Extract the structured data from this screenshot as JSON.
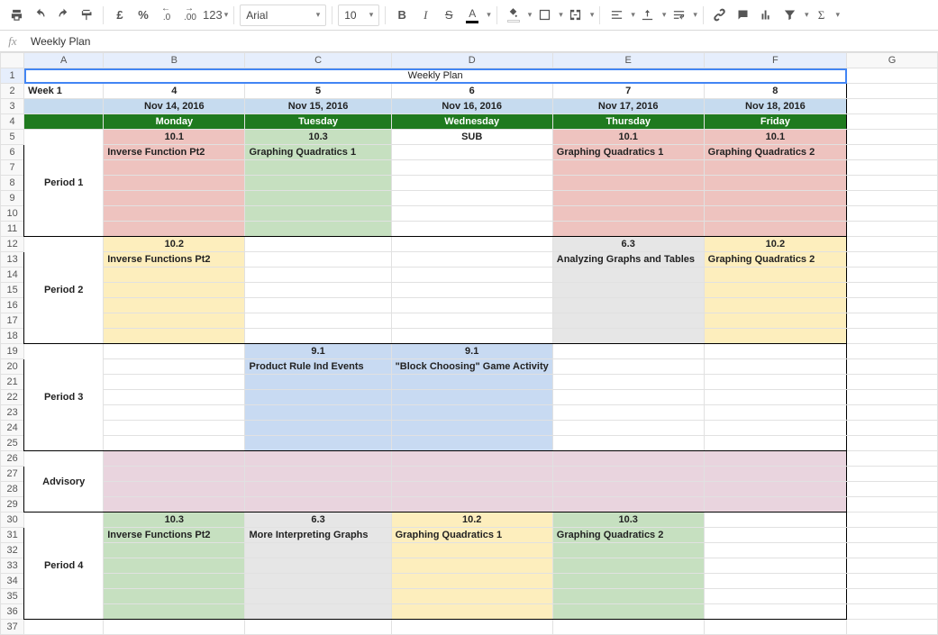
{
  "toolbar": {
    "font": "Arial",
    "size": "10",
    "currency_sym": "£",
    "percent": "%",
    "decimal_dec": ".0",
    "decimal_inc": ".00",
    "more_formats": "123",
    "bold": "B",
    "italic": "I",
    "strike": "S",
    "text_color": "A",
    "sigma": "Σ"
  },
  "formula_bar": {
    "fx": "fx",
    "value": "Weekly Plan"
  },
  "columns": [
    "A",
    "B",
    "C",
    "D",
    "E",
    "F",
    "G"
  ],
  "rows_count": 37,
  "colors": {
    "blue_header": "#c6dbef",
    "green_header": "#1f7a1f",
    "red_block": "#eec3bf",
    "green_block": "#c6e0c0",
    "yellow_block": "#fdeebd",
    "grey_block": "#e6e6e6",
    "blue_block": "#c8daf2",
    "pink_block": "#e9d4de",
    "white": "#ffffff"
  },
  "plan": {
    "title": "Weekly Plan",
    "week_label": "Week 1",
    "week_nums": [
      "4",
      "5",
      "6",
      "7",
      "8"
    ],
    "dates": [
      "Nov 14, 2016",
      "Nov 15, 2016",
      "Nov 16, 2016",
      "Nov 17, 2016",
      "Nov 18, 2016"
    ],
    "days": [
      "Monday",
      "Tuesday",
      "Wednesday",
      "Thursday",
      "Friday"
    ],
    "periods": [
      "Period 1",
      "Period 2",
      "Period 3",
      "Advisory",
      "Period 4"
    ],
    "blocks": {
      "p1": {
        "mon": {
          "num": "10.1",
          "topic": "Inverse Function Pt2",
          "color": "red_block"
        },
        "tue": {
          "num": "10.3",
          "topic": "Graphing Quadratics 1",
          "color": "green_block"
        },
        "wed": {
          "num": "SUB",
          "topic": "",
          "color": "white"
        },
        "thu": {
          "num": "10.1",
          "topic": "Graphing Quadratics 1",
          "color": "red_block"
        },
        "fri": {
          "num": "10.1",
          "topic": "Graphing Quadratics 2",
          "color": "red_block"
        }
      },
      "p2": {
        "mon": {
          "num": "10.2",
          "topic": "Inverse Functions Pt2",
          "color": "yellow_block"
        },
        "tue": {
          "num": "",
          "topic": "",
          "color": "white"
        },
        "wed": {
          "num": "",
          "topic": "",
          "color": "white"
        },
        "thu": {
          "num": "6.3",
          "topic": "Analyzing Graphs and Tables",
          "color": "grey_block"
        },
        "fri": {
          "num": "10.2",
          "topic": "Graphing Quadratics 2",
          "color": "yellow_block"
        }
      },
      "p3": {
        "mon": {
          "num": "",
          "topic": "",
          "color": "white"
        },
        "tue": {
          "num": "9.1",
          "topic": "Product Rule Ind Events",
          "color": "blue_block"
        },
        "wed": {
          "num": "9.1",
          "topic": "\"Block Choosing\" Game Activity",
          "color": "blue_block"
        },
        "thu": {
          "num": "",
          "topic": "",
          "color": "white"
        },
        "fri": {
          "num": "",
          "topic": "",
          "color": "white"
        }
      },
      "adv": {
        "mon": {
          "color": "pink_block"
        },
        "tue": {
          "color": "pink_block"
        },
        "wed": {
          "color": "pink_block"
        },
        "thu": {
          "color": "pink_block"
        },
        "fri": {
          "color": "pink_block"
        }
      },
      "p4": {
        "mon": {
          "num": "10.3",
          "topic": "Inverse Functions Pt2",
          "color": "green_block"
        },
        "tue": {
          "num": "6.3",
          "topic": "More Interpreting Graphs",
          "color": "grey_block"
        },
        "wed": {
          "num": "10.2",
          "topic": "Graphing Quadratics 1",
          "color": "yellow_block"
        },
        "thu": {
          "num": "10.3",
          "topic": "Graphing Quadratics 2",
          "color": "green_block"
        },
        "fri": {
          "num": "",
          "topic": "",
          "color": "white"
        }
      }
    }
  }
}
